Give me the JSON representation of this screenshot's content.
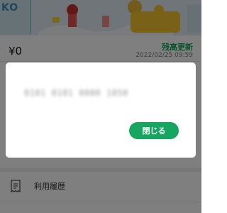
{
  "card": {
    "logo_text": "KO"
  },
  "balance": {
    "amount": "¥0",
    "refresh_label": "残高更新",
    "updated_at": "2022/02/25 09:59"
  },
  "menu": {
    "history_label": "利用履歴",
    "history_icon": "receipt-icon"
  },
  "dialog": {
    "card_number": "0101 0101 0000 1050",
    "close_label": "閉じる"
  },
  "colors": {
    "accent": "#17a661",
    "overlay": "rgba(0,0,0,0.5)"
  }
}
